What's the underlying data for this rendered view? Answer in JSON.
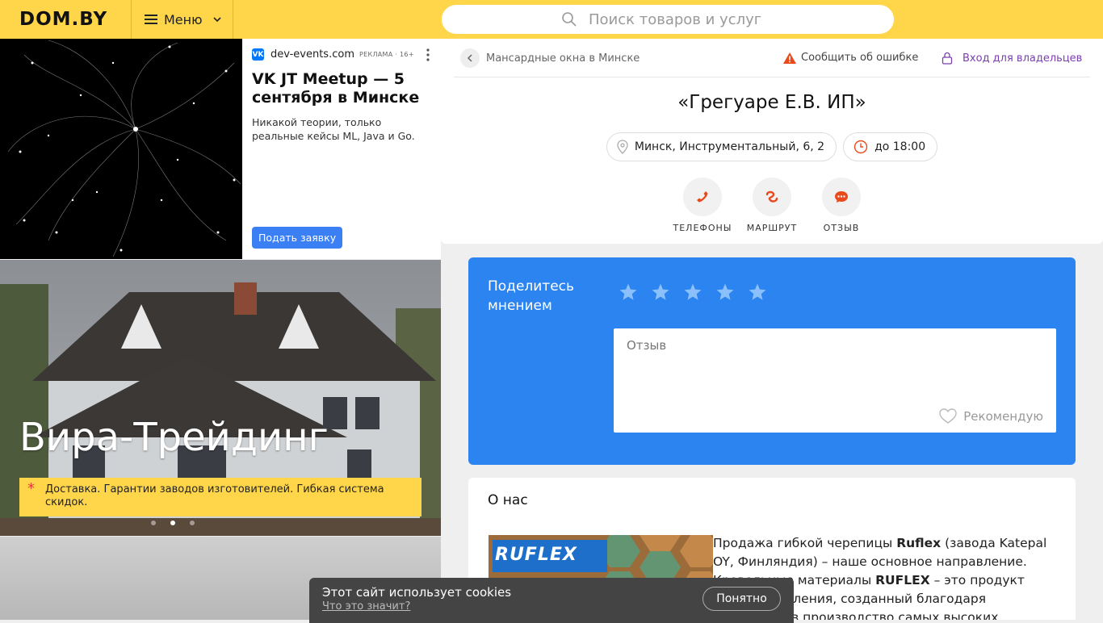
{
  "header": {
    "logo": "DOM.BY",
    "menu_label": "Меню",
    "search_placeholder": "Поиск товаров и услуг"
  },
  "ad": {
    "source": "dev-events.com",
    "mark": "РЕКЛАМА · 16+",
    "title": "VK JT Meetup — 5 сентября в Минске",
    "text": "Никакой теории, только реальные кейсы ML, Java и Go.",
    "cta": "Подать заявку"
  },
  "banner": {
    "title": "Вира-Трейдинг",
    "note": "Доставка. Гарантии заводов изготовителей. Гибкая система скидок.",
    "active_slide": 1,
    "slides": 3
  },
  "card": {
    "breadcrumb": "Мансардные окна в Минске",
    "report_label": "Сообщить об ошибке",
    "owner_label": "Вход для владельцев",
    "firm_name": "«Грегуаре Е.В. ИП»",
    "address": "Минск, Инструментальный, 6, 2",
    "hours": "до 18:00",
    "actions": [
      {
        "label": "ТЕЛЕФОНЫ",
        "icon": "phone-icon"
      },
      {
        "label": "МАРШРУТ",
        "icon": "route-icon"
      },
      {
        "label": "ОТЗЫВ",
        "icon": "chat-icon"
      }
    ]
  },
  "review": {
    "title": "Поделитесь мнением",
    "placeholder": "Отзыв",
    "recommend": "Рекомендую",
    "stars_total": 5
  },
  "about": {
    "title": "О нас",
    "logo_text": "RUFLEX",
    "text_parts": [
      "Продажа гибкой черепицы ",
      "Ruflex",
      " (завода Katepal OY, Финляндия) – наше основное направление. Кровельные материалы ",
      "RUFLEX",
      " – это продукт нового поколения, созданный благодаря внедрению в производство самых высоких технологий."
    ]
  },
  "cookie": {
    "text": "Этот сайт использует cookies",
    "link": "Что это значит?",
    "button": "Понятно"
  },
  "colors": {
    "header": "#ffd54a",
    "accent_blue": "#2b84f0",
    "action_icons": "#e84a1e",
    "owner_link": "#7b3fb0"
  }
}
